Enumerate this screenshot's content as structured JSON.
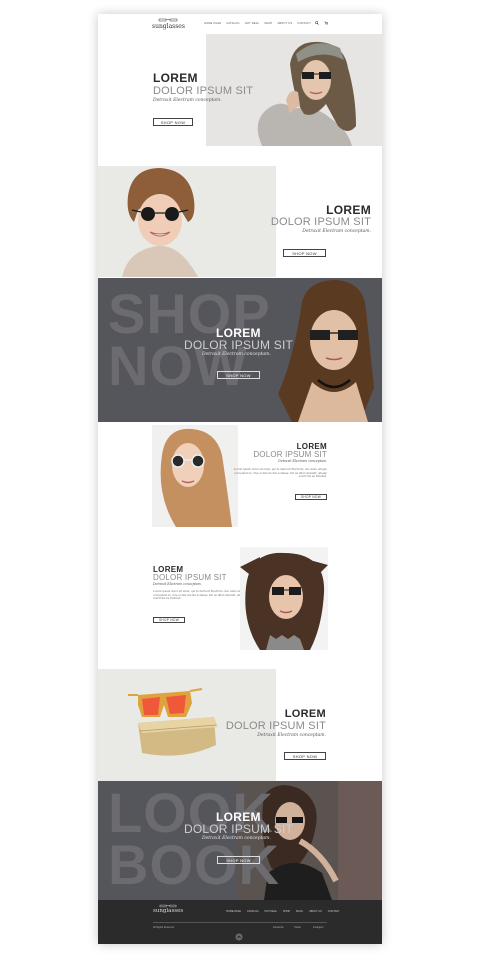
{
  "header": {
    "logo": "sunglasses",
    "nav": [
      "HOME PAGE",
      "CATALOG",
      "HOT DEAL",
      "SHOP",
      "BLOG",
      "ABOUT US",
      "CONTACT"
    ]
  },
  "sections": [
    {
      "lorem": "LOREM",
      "dolor": "DOLOR IPSUM SIT",
      "sub": "Detraxit Electram conceptam.",
      "button": "SHOP NOW"
    },
    {
      "lorem": "LOREM",
      "dolor": "DOLOR IPSUM SIT",
      "sub": "Detraxit Electram conceptam.",
      "button": "SHOP NOW"
    },
    {
      "bg_text_1": "SHOP",
      "bg_text_2": "NOW",
      "lorem": "LOREM",
      "dolor": "DOLOR IPSUM SIT",
      "sub": "Detraxit Electram conceptam.",
      "button": "SHOP NOW"
    },
    {
      "lorem": "LOREM",
      "dolor": "DOLOR IPSUM SIT",
      "sub": "Detraxit Electram conceptam.",
      "paragraph": "Lorem ipsum dolor sit amet, qui te detraxit Electram, duo iusto aliquip conceptam te. Nos ei nisl doctus noluisse. Vel ne illum deleniti, aliquip everti his eu Putabat.",
      "button": "SHOP NOW"
    },
    {
      "lorem": "LOREM",
      "dolor": "DOLOR IPSUM SIT",
      "sub": "Detraxit Electram conceptam.",
      "paragraph": "Lorem ipsum dolor sit amet, qui te detraxit Electram, duo iusto aliquip conceptam te. Nos ei nisl doctus noluisse. Vel ne illum deleniti, aliquip everti his eu Putabat.",
      "button": "SHOP NOW"
    },
    {
      "lorem": "LOREM",
      "dolor": "DOLOR IPSUM SIT",
      "sub": "Detraxit Electram conceptam.",
      "button": "SHOP NOW"
    },
    {
      "bg_text_1": "LOOK",
      "bg_text_2": "BOOK",
      "lorem": "LOREM",
      "dolor": "DOLOR IPSUM SIT",
      "sub": "Detraxit Electram conceptam.",
      "button": "SHOP NOW"
    }
  ],
  "footer": {
    "logo": "sunglasses",
    "nav": [
      "HOME PAGE",
      "CATALOG",
      "HOT DEAL",
      "SHOP",
      "BLOG",
      "ABOUT US",
      "CONTACT"
    ],
    "copyright": "All Rights Reserved",
    "social": [
      "Facebook",
      "Twitter",
      "Instagram"
    ]
  },
  "colors": {
    "dark_band": "#55555c",
    "footer": "#2b2b2b",
    "light_panel": "#e9e9e6"
  }
}
